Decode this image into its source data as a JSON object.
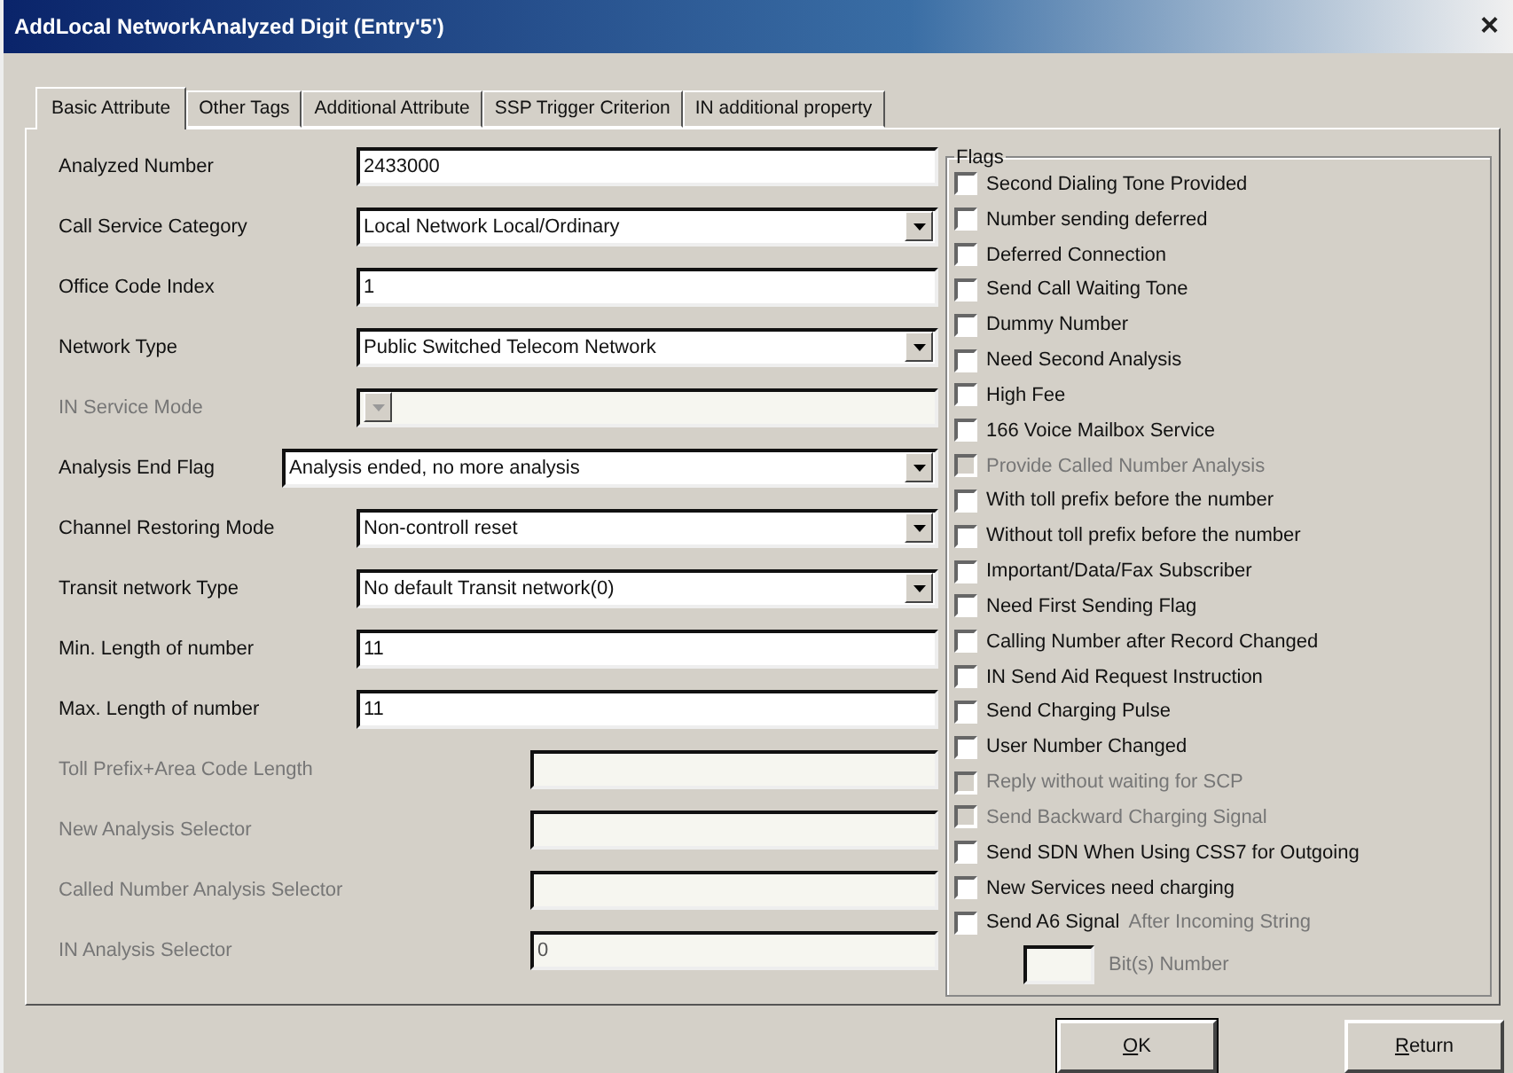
{
  "window": {
    "title": "AddLocal NetworkAnalyzed Digit (Entry'5')",
    "close": "×"
  },
  "tabs": [
    {
      "label": "Basic Attribute",
      "selected": true
    },
    {
      "label": "Other Tags",
      "selected": false
    },
    {
      "label": "Additional Attribute",
      "selected": false
    },
    {
      "label": "SSP Trigger Criterion",
      "selected": false
    },
    {
      "label": "IN additional property",
      "selected": false
    }
  ],
  "fields": [
    {
      "label": "Analyzed Number",
      "kind": "text",
      "value": "2433000",
      "disabled": false
    },
    {
      "label": "Call Service Category",
      "kind": "combo",
      "value": "Local Network Local/Ordinary",
      "disabled": false
    },
    {
      "label": "Office Code Index",
      "kind": "text",
      "value": "1",
      "disabled": false
    },
    {
      "label": "Network Type",
      "kind": "combo",
      "value": "Public Switched Telecom Network",
      "disabled": false
    },
    {
      "label": "IN Service Mode",
      "kind": "combo",
      "disabled": true
    },
    {
      "label": "Analysis End Flag",
      "kind": "wide_combo",
      "value": "Analysis ended, no more analysis",
      "disabled": false
    },
    {
      "label": "Channel Restoring Mode",
      "kind": "combo",
      "value": "Non-controll reset",
      "disabled": false
    },
    {
      "label": "Transit network Type",
      "kind": "combo",
      "value": "No default Transit network(0)",
      "disabled": false
    },
    {
      "label": "Min. Length of number",
      "kind": "text",
      "value": "11",
      "disabled": false
    },
    {
      "label": "Max. Length of number",
      "kind": "text",
      "value": "11",
      "disabled": false
    },
    {
      "label": "Toll Prefix+Area Code Length",
      "kind": "short_text",
      "disabled": true
    },
    {
      "label": "New Analysis Selector",
      "kind": "short_text",
      "disabled": true
    },
    {
      "label": "Called Number Analysis Selector",
      "kind": "short_text",
      "disabled": true
    },
    {
      "label": "IN Analysis Selector",
      "kind": "short_text",
      "value": "0",
      "disabled": true
    }
  ],
  "flags": {
    "title": "Flags",
    "items": [
      {
        "label": "Second Dialing Tone Provided",
        "checked": false,
        "disabled": false
      },
      {
        "label": "Number sending deferred",
        "checked": false,
        "disabled": false
      },
      {
        "label": "Deferred Connection",
        "checked": false,
        "disabled": false
      },
      {
        "label": "Send Call Waiting Tone",
        "checked": false,
        "disabled": false
      },
      {
        "label": "Dummy Number",
        "checked": false,
        "disabled": false
      },
      {
        "label": "Need Second Analysis",
        "checked": false,
        "disabled": false
      },
      {
        "label": "High Fee",
        "checked": false,
        "disabled": false
      },
      {
        "label": "166 Voice Mailbox Service",
        "checked": false,
        "disabled": false
      },
      {
        "label": "Provide Called Number Analysis",
        "checked": false,
        "disabled": true
      },
      {
        "label": "With toll prefix before the number",
        "checked": false,
        "disabled": false
      },
      {
        "label": "Without toll prefix before the number",
        "checked": false,
        "disabled": false
      },
      {
        "label": "Important/Data/Fax Subscriber",
        "checked": false,
        "disabled": false
      },
      {
        "label": "Need First Sending Flag",
        "checked": false,
        "disabled": false
      },
      {
        "label": "Calling Number after Record Changed",
        "checked": false,
        "disabled": false
      },
      {
        "label": "IN Send Aid Request Instruction",
        "checked": false,
        "disabled": false
      },
      {
        "label": "Send Charging Pulse",
        "checked": false,
        "disabled": false
      },
      {
        "label": "User Number Changed",
        "checked": false,
        "disabled": false
      },
      {
        "label": "Reply without waiting for SCP",
        "checked": false,
        "disabled": true
      },
      {
        "label": "Send Backward Charging Signal",
        "checked": false,
        "disabled": true
      },
      {
        "label": "Send SDN When Using CSS7 for Outgoing",
        "checked": false,
        "disabled": false
      },
      {
        "label": "New Services need charging",
        "checked": false,
        "disabled": false
      },
      {
        "label": "Send A6 Signal",
        "checked": false,
        "disabled": false,
        "note": "After Incoming String"
      }
    ],
    "bits": {
      "label": "Bit(s) Number",
      "disabled": true
    }
  },
  "buttons": [
    "OK",
    "Return"
  ]
}
